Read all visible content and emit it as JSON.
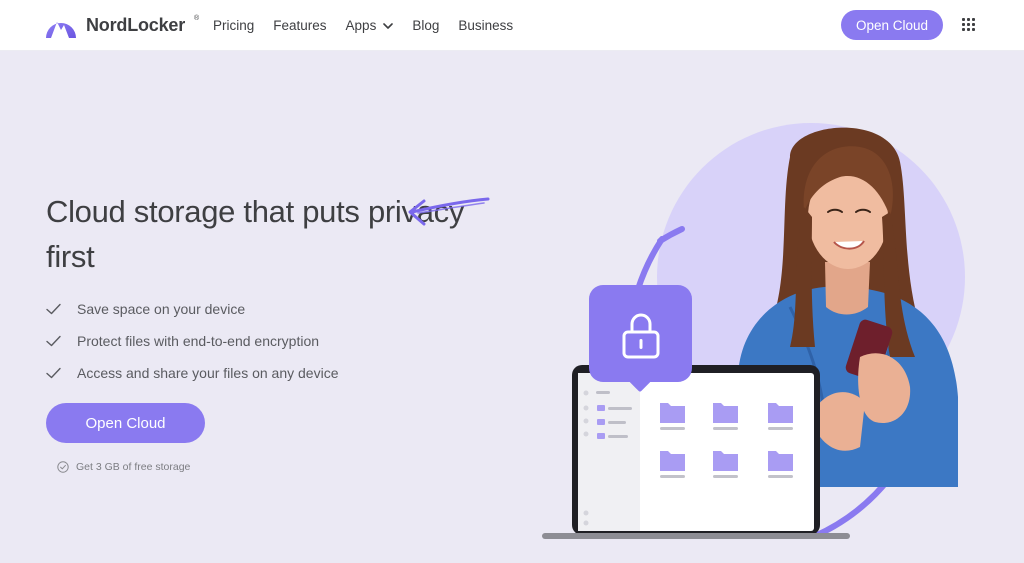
{
  "header": {
    "brand": "NordLocker",
    "brand_reg": "®",
    "nav": [
      {
        "label": "Pricing"
      },
      {
        "label": "Features"
      },
      {
        "label": "Apps",
        "icon": "chevron-down-icon"
      },
      {
        "label": "Blog"
      },
      {
        "label": "Business"
      }
    ],
    "cta_label": "Open Cloud",
    "apps_menu_icon": "grid-icon"
  },
  "hero": {
    "title": "Cloud storage that puts privacy first",
    "features": [
      "Save space on your device",
      "Protect files with end-to-end encryption",
      "Access and share your files on any device"
    ],
    "cta_label": "Open Cloud",
    "note": "Get 3 GB of free storage"
  },
  "colors": {
    "accent": "#8a7af0",
    "hero_background": "#ebe9f4",
    "circle": "#d8d2f9",
    "text": "#3e3f42"
  }
}
